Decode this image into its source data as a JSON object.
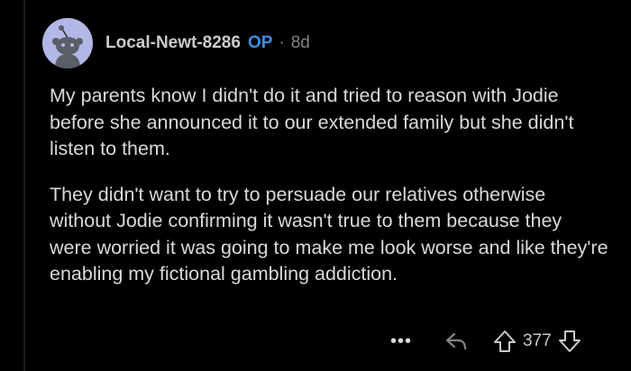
{
  "comment": {
    "author": "Local-Newt-8286",
    "op_label": "OP",
    "separator": "·",
    "age": "8d",
    "avatar_icon": "snoo-avatar-icon",
    "paragraphs": [
      "My parents know I didn't do it and tried to reason with Jodie before she announced it to our extended family but she didn't listen to them.",
      "They didn't want to try to persuade our relatives otherwise without Jodie confirming it wasn't true to them because they were worried it was going to make me look worse and like they're enabling my fictional gambling addiction."
    ]
  },
  "actions": {
    "more_label": "•••",
    "reply_icon": "reply-arrow-icon",
    "upvote_icon": "upvote-arrow-icon",
    "score": "377",
    "downvote_icon": "downvote-arrow-icon"
  },
  "colors": {
    "background": "#000000",
    "text": "#d7dadc",
    "muted": "#818384",
    "op": "#3d8fe3",
    "avatar_bg": "#b2b8e6"
  }
}
